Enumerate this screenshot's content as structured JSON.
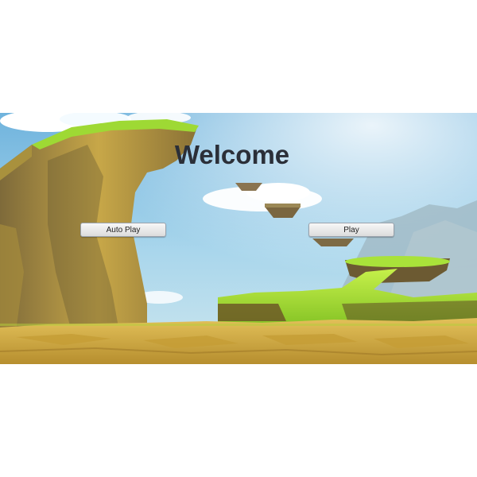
{
  "screen": {
    "title": "Welcome"
  },
  "buttons": {
    "auto_play_label": "Auto Play",
    "play_label": "Play"
  },
  "colors": {
    "page_background": "#ffffff",
    "sky": "#8ec8e8",
    "grass": "#9ed934",
    "cliff": "#b8983e",
    "ground": "#d9b449",
    "title_text": "#2b2f38"
  }
}
